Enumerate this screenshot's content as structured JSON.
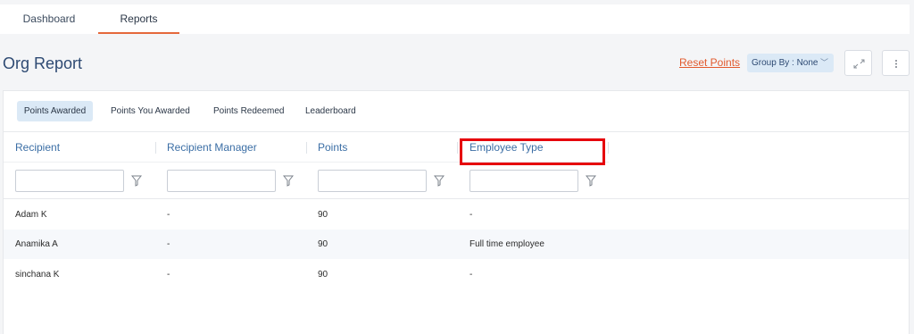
{
  "top_tabs": [
    {
      "label": "Dashboard"
    },
    {
      "label": "Reports"
    }
  ],
  "page": {
    "title": "Org Report"
  },
  "actions": {
    "reset_label": "Reset Points",
    "group_by_label": "Group By : None",
    "group_by_chevron": "﹀"
  },
  "subtabs": [
    {
      "label": "Points Awarded"
    },
    {
      "label": "Points You Awarded"
    },
    {
      "label": "Points Redeemed"
    },
    {
      "label": "Leaderboard"
    }
  ],
  "table": {
    "columns": [
      "Recipient",
      "Recipient Manager",
      "Points",
      "Employee Type"
    ],
    "rows": [
      {
        "recipient": "Adam K",
        "manager": "-",
        "points": "90",
        "employee_type": "-"
      },
      {
        "recipient": "Anamika A",
        "manager": "-",
        "points": "90",
        "employee_type": "Full time employee"
      },
      {
        "recipient": "sinchana K",
        "manager": "-",
        "points": "90",
        "employee_type": "-"
      }
    ]
  },
  "colors": {
    "accent": "#e5683b",
    "title": "#2e4a73",
    "link": "#e25a2e",
    "highlight": "#e6000c"
  }
}
